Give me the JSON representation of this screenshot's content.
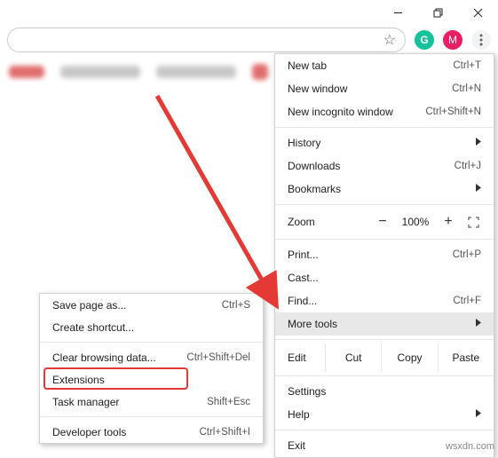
{
  "window_controls": {
    "minimize": "–",
    "maximize": "□",
    "close": "×"
  },
  "toolbar": {
    "grammarly_initial": "G",
    "profile_initial": "M"
  },
  "main_menu": {
    "new_tab": {
      "label": "New tab",
      "shortcut": "Ctrl+T"
    },
    "new_window": {
      "label": "New window",
      "shortcut": "Ctrl+N"
    },
    "new_incognito": {
      "label": "New incognito window",
      "shortcut": "Ctrl+Shift+N"
    },
    "history": {
      "label": "History"
    },
    "downloads": {
      "label": "Downloads",
      "shortcut": "Ctrl+J"
    },
    "bookmarks": {
      "label": "Bookmarks"
    },
    "zoom": {
      "label": "Zoom",
      "minus": "−",
      "value": "100%",
      "plus": "+"
    },
    "print": {
      "label": "Print...",
      "shortcut": "Ctrl+P"
    },
    "cast": {
      "label": "Cast..."
    },
    "find": {
      "label": "Find...",
      "shortcut": "Ctrl+F"
    },
    "more_tools": {
      "label": "More tools"
    },
    "edit": {
      "label": "Edit",
      "cut": "Cut",
      "copy": "Copy",
      "paste": "Paste"
    },
    "settings": {
      "label": "Settings"
    },
    "help": {
      "label": "Help"
    },
    "exit": {
      "label": "Exit"
    }
  },
  "sub_menu": {
    "save_page": {
      "label": "Save page as...",
      "shortcut": "Ctrl+S"
    },
    "create_shortcut": {
      "label": "Create shortcut..."
    },
    "clear_browsing": {
      "label": "Clear browsing data...",
      "shortcut": "Ctrl+Shift+Del"
    },
    "extensions": {
      "label": "Extensions"
    },
    "task_manager": {
      "label": "Task manager",
      "shortcut": "Shift+Esc"
    },
    "developer_tools": {
      "label": "Developer tools",
      "shortcut": "Ctrl+Shift+I"
    }
  },
  "watermark": "wsxdn.com"
}
